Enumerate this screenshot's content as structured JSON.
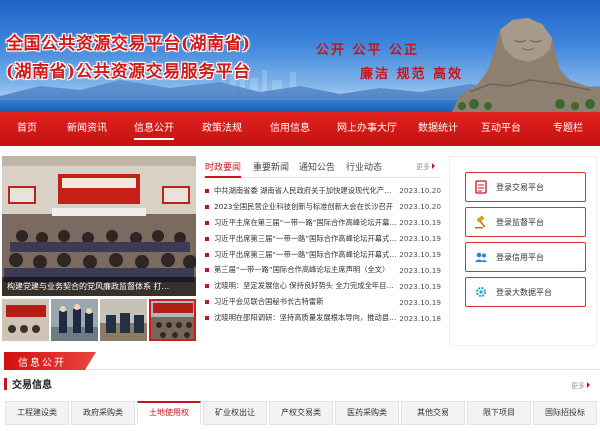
{
  "header": {
    "title_line1": "全国公共资源交易平台(湖南省)",
    "title_line2": "(湖南省)公共资源交易服务平台",
    "slogan_line1": "公开  公平  公正",
    "slogan_line2": "廉洁  规范  高效"
  },
  "nav": {
    "items": [
      {
        "label": "首页"
      },
      {
        "label": "新闻资讯"
      },
      {
        "label": "信息公开"
      },
      {
        "label": "政策法规"
      },
      {
        "label": "信用信息"
      },
      {
        "label": "网上办事大厅"
      },
      {
        "label": "数据统计"
      },
      {
        "label": "互动平台"
      },
      {
        "label": "专题栏"
      }
    ],
    "active_index": 2
  },
  "carousel": {
    "caption": "构建党建与业务契合的党风廉政监督体系 打..."
  },
  "news": {
    "tabs": [
      {
        "label": "时政要闻"
      },
      {
        "label": "重要新闻"
      },
      {
        "label": "通知公告"
      },
      {
        "label": "行业动态"
      }
    ],
    "active_tab": 0,
    "more_label": "更多",
    "items": [
      {
        "title": "中共湖南省委 湖南省人民政府关于加快建设现代化产业...",
        "date": "2023.10.20"
      },
      {
        "title": "2023全国民营企业科技创新与标准创新大会在长沙召开",
        "date": "2023.10.20"
      },
      {
        "title": "习近平主席在第三届“一带一路”国际合作高峰论坛开幕...",
        "date": "2023.10.19"
      },
      {
        "title": "习近平出席第三届“一带一路”国际合作高峰论坛开幕式...",
        "date": "2023.10.19"
      },
      {
        "title": "习近平出席第三届“一带一路”国际合作高峰论坛开幕式上...",
        "date": "2023.10.19"
      },
      {
        "title": "第三届“一带一路”国际合作高峰论坛主席声明（全文）",
        "date": "2023.10.19"
      },
      {
        "title": "沈晓明：坚定发展信心 保持良好势头 全力完成全年目标...",
        "date": "2023.10.19"
      },
      {
        "title": "习近平会见联合国秘书长古特雷斯",
        "date": "2023.10.19"
      },
      {
        "title": "沈晓明在邵阳调研：坚持高质量发展根本导向，推动县域...",
        "date": "2023.10.18"
      }
    ]
  },
  "login": {
    "buttons": [
      {
        "label": "登录交易平台",
        "icon": "document-icon"
      },
      {
        "label": "登录监督平台",
        "icon": "gavel-icon"
      },
      {
        "label": "登录信用平台",
        "icon": "users-icon"
      },
      {
        "label": "登录大数据平台",
        "icon": "gear-icon"
      }
    ]
  },
  "info_section": {
    "badge": "信息公开"
  },
  "trading": {
    "title": "交易信息",
    "more_label": "更多",
    "tabs": [
      {
        "label": "工程建设类"
      },
      {
        "label": "政府采购类"
      },
      {
        "label": "土地使用权"
      },
      {
        "label": "矿业权出让"
      },
      {
        "label": "产权交易类"
      },
      {
        "label": "医药采购类"
      },
      {
        "label": "其他交易"
      },
      {
        "label": "限下项目"
      },
      {
        "label": "国际招投标"
      }
    ],
    "active_tab": 2
  },
  "colors": {
    "brand_red": "#c8141b",
    "nav_red": "#d91b18",
    "sky_blue": "#3f86dc"
  }
}
